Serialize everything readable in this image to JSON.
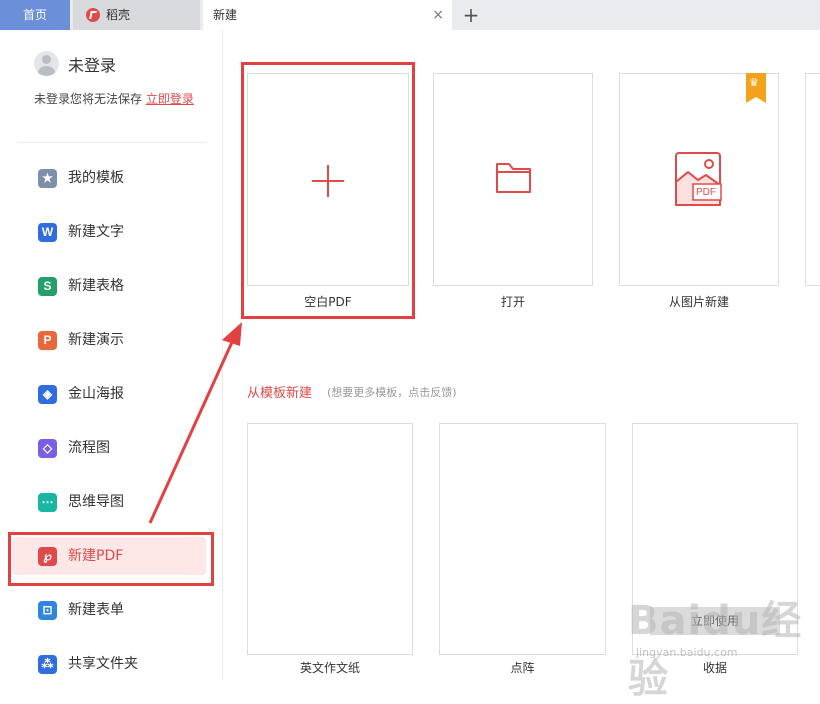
{
  "tabs": [
    {
      "label": "首页"
    },
    {
      "label": "稻壳"
    },
    {
      "label": "新建"
    }
  ],
  "tab_close_icon": "×",
  "tab_add_icon": "+",
  "user": {
    "name": "未登录",
    "tip": "未登录您将无法保存",
    "login_link": "立即登录"
  },
  "sidebar": {
    "items": [
      {
        "label": "我的模板",
        "icon": "star-icon",
        "color": "#7d8fa9"
      },
      {
        "label": "新建文字",
        "icon": "word-icon",
        "color": "#2f6de1"
      },
      {
        "label": "新建表格",
        "icon": "sheet-icon",
        "color": "#22a06b"
      },
      {
        "label": "新建演示",
        "icon": "ppt-icon",
        "color": "#e8673b"
      },
      {
        "label": "金山海报",
        "icon": "poster-icon",
        "color": "#2f6de1"
      },
      {
        "label": "流程图",
        "icon": "flowchart-icon",
        "color": "#7a5ee6"
      },
      {
        "label": "思维导图",
        "icon": "mindmap-icon",
        "color": "#19b6a4"
      },
      {
        "label": "新建PDF",
        "icon": "pdf-icon",
        "color": "#e14a4a"
      },
      {
        "label": "新建表单",
        "icon": "form-icon",
        "color": "#2f86e1"
      },
      {
        "label": "共享文件夹",
        "icon": "share-folder-icon",
        "color": "#2f6de1"
      }
    ],
    "active": "新建PDF"
  },
  "create_cards": [
    {
      "label": "空白PDF",
      "icon": "plus-icon"
    },
    {
      "label": "打开",
      "icon": "folder-icon"
    },
    {
      "label": "从图片新建",
      "icon": "image-pdf-icon",
      "badge_icon": "crown-icon"
    }
  ],
  "image_pdf_text": "PDF",
  "template_section": {
    "title": "从模板新建",
    "hint": "(想要更多模板，点击反馈)"
  },
  "templates": [
    {
      "label": "英文作文纸"
    },
    {
      "label": "点阵"
    },
    {
      "label": "收据"
    }
  ],
  "preview_button": "立即使用",
  "watermark": {
    "text": "Baidu经验",
    "sub": "jingyan.baidu.com"
  },
  "colors": {
    "accent": "#e14a4a",
    "highlight": "#e24141",
    "home_tab": "#6b8fd8"
  }
}
